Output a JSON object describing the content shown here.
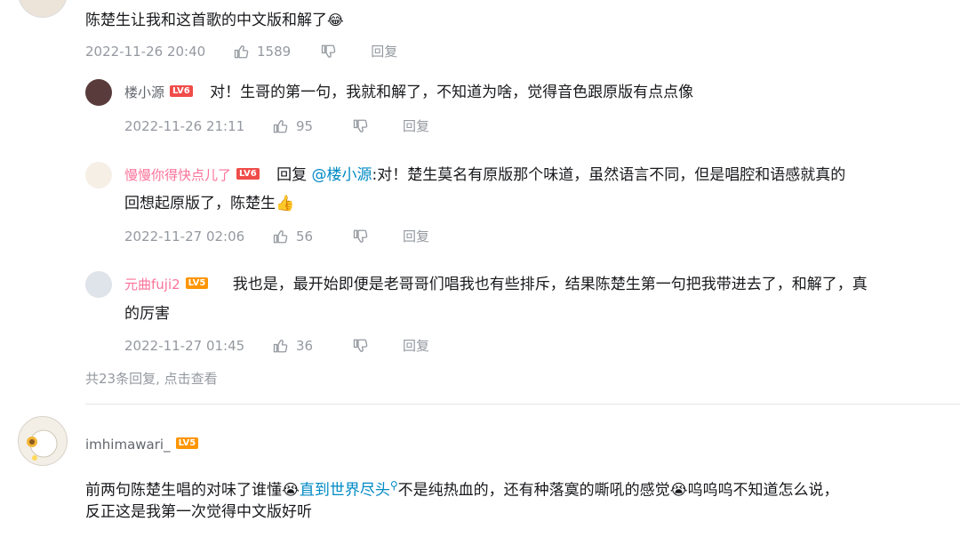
{
  "top_comment": {
    "text": "陈楚生让我和这首歌的中文版和解了",
    "emoji": "😂",
    "time": "2022-11-26 20:40",
    "likes": "1589",
    "reply_label": "回复"
  },
  "replies": [
    {
      "username": "楼小源",
      "level": "LV6",
      "text": "对！生哥的第一句，我就和解了，不知道为啥，觉得音色跟原版有点点像",
      "time": "2022-11-26 21:11",
      "likes": "95",
      "reply_label": "回复"
    },
    {
      "username": "慢慢你得快点儿了",
      "level": "LV6",
      "reply_prefix": "回复",
      "mention": "@楼小源",
      "text_line1": ":对！楚生莫名有原版那个味道，虽然语言不同，但是唱腔和语感就真的",
      "text_line2": "回想起原版了，陈楚生",
      "emoji": "👍",
      "time": "2022-11-27 02:06",
      "likes": "56",
      "reply_label": "回复"
    },
    {
      "username": "元曲fuji2",
      "level": "LV5",
      "text_line1": "我也是，最开始即便是老哥哥们唱我也有些排斥，结果陈楚生第一句把我带进去了，和解了，真",
      "text_line2": "的厉害",
      "time": "2022-11-27 01:45",
      "likes": "36",
      "reply_label": "回复"
    }
  ],
  "more_replies": "共23条回复, 点击查看",
  "second_comment": {
    "username": "imhimawari_",
    "level": "LV5",
    "text_part1": "前两句陈楚生唱的对味了谁懂",
    "emoji1": "😭",
    "link_text": "直到世界尽头",
    "text_part2": "不是纯热血的，还有种落寞的嘶吼的感觉",
    "emoji2": "😭",
    "text_part3": "呜呜呜不知道怎么说，",
    "text_line2": "反正这是我第一次觉得中文版好听"
  }
}
